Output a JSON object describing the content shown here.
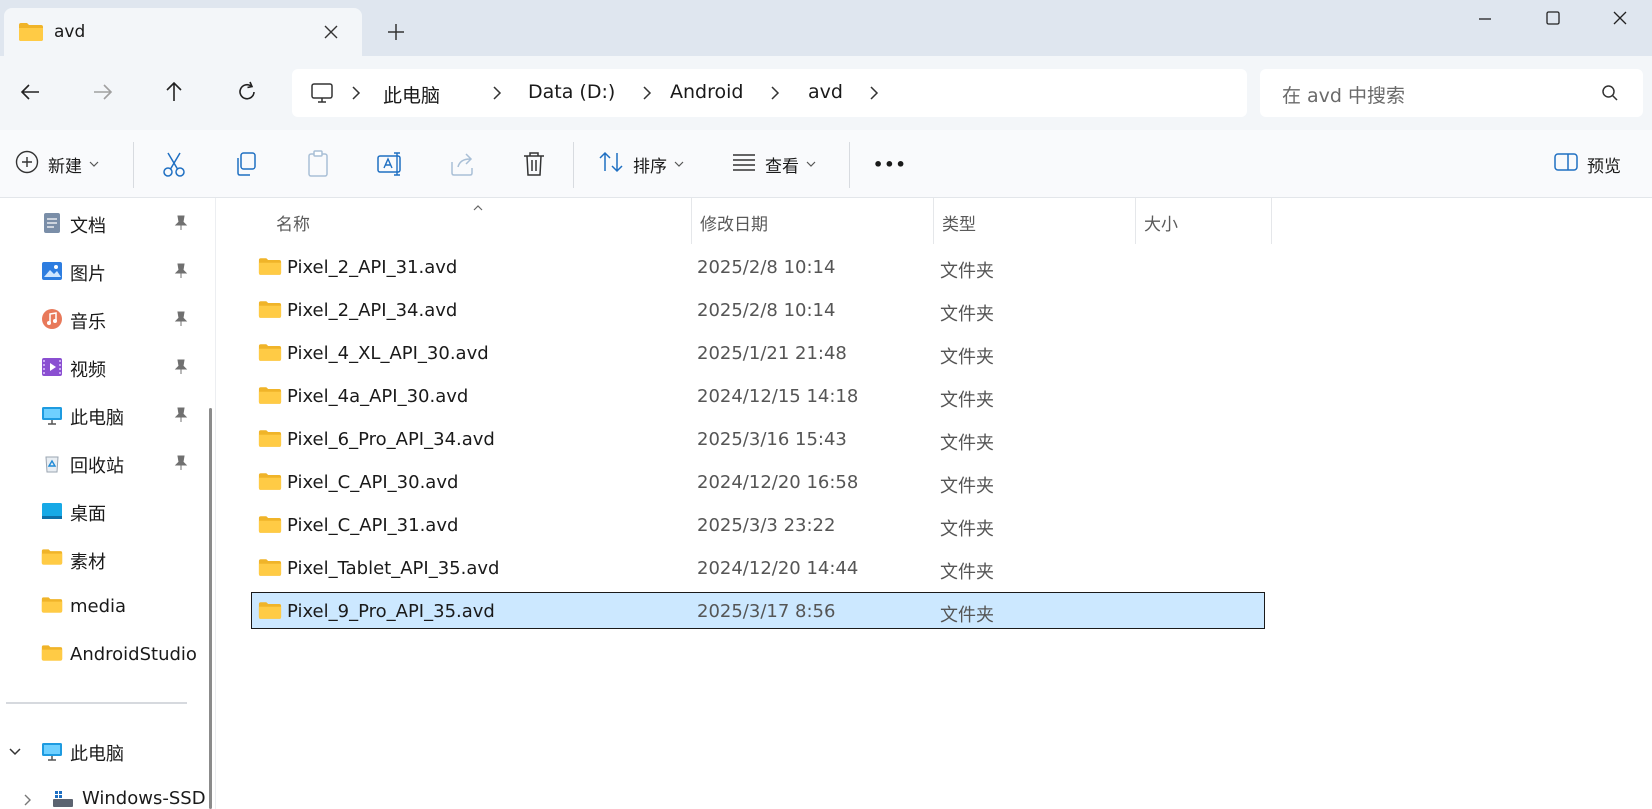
{
  "tab": {
    "title": "avd",
    "new_tab_label": "+"
  },
  "window": {
    "minimize": "minimize",
    "maximize": "maximize",
    "close": "close"
  },
  "address": {
    "breadcrumbs": [
      "此电脑",
      "Data (D:)",
      "Android",
      "avd"
    ]
  },
  "search": {
    "placeholder": "在 avd 中搜索"
  },
  "commandbar": {
    "new_label": "新建",
    "sort_label": "排序",
    "view_label": "查看",
    "more_label": "•••",
    "preview_label": "预览"
  },
  "sidebar": {
    "items": [
      {
        "label": "文档",
        "icon": "documents-icon",
        "pinned": true
      },
      {
        "label": "图片",
        "icon": "pictures-icon",
        "pinned": true
      },
      {
        "label": "音乐",
        "icon": "music-icon",
        "pinned": true
      },
      {
        "label": "视频",
        "icon": "videos-icon",
        "pinned": true
      },
      {
        "label": "此电脑",
        "icon": "this-pc-icon",
        "pinned": true
      },
      {
        "label": "回收站",
        "icon": "recycle-bin-icon",
        "pinned": true
      },
      {
        "label": "桌面",
        "icon": "desktop-icon",
        "pinned": false
      },
      {
        "label": "素材",
        "icon": "folder-icon",
        "pinned": false
      },
      {
        "label": "media",
        "icon": "folder-icon",
        "pinned": false
      },
      {
        "label": "AndroidStudio",
        "icon": "folder-icon",
        "pinned": false
      }
    ],
    "tree": [
      {
        "label": "此电脑",
        "expanded": true
      },
      {
        "label": "Windows-SSD",
        "expanded": false
      }
    ]
  },
  "columns": {
    "name": "名称",
    "date": "修改日期",
    "type": "类型",
    "size": "大小"
  },
  "files": [
    {
      "name": "Pixel_2_API_31.avd",
      "date": "2025/2/8 10:14",
      "type": "文件夹",
      "size": "",
      "selected": false
    },
    {
      "name": "Pixel_2_API_34.avd",
      "date": "2025/2/8 10:14",
      "type": "文件夹",
      "size": "",
      "selected": false
    },
    {
      "name": "Pixel_4_XL_API_30.avd",
      "date": "2025/1/21 21:48",
      "type": "文件夹",
      "size": "",
      "selected": false
    },
    {
      "name": "Pixel_4a_API_30.avd",
      "date": "2024/12/15 14:18",
      "type": "文件夹",
      "size": "",
      "selected": false
    },
    {
      "name": "Pixel_6_Pro_API_34.avd",
      "date": "2025/3/16 15:43",
      "type": "文件夹",
      "size": "",
      "selected": false
    },
    {
      "name": "Pixel_C_API_30.avd",
      "date": "2024/12/20 16:58",
      "type": "文件夹",
      "size": "",
      "selected": false
    },
    {
      "name": "Pixel_C_API_31.avd",
      "date": "2025/3/3 23:22",
      "type": "文件夹",
      "size": "",
      "selected": false
    },
    {
      "name": "Pixel_Tablet_API_35.avd",
      "date": "2024/12/20 14:44",
      "type": "文件夹",
      "size": "",
      "selected": false
    },
    {
      "name": "Pixel_9_Pro_API_35.avd",
      "date": "2025/3/17 8:56",
      "type": "文件夹",
      "size": "",
      "selected": true
    }
  ],
  "colors": {
    "titlebar_bg": "#dfe6ef",
    "toolbar_bg": "#f3f6f9",
    "selection_bg": "#cce8ff",
    "folder_yellow": "#ffcb45"
  }
}
